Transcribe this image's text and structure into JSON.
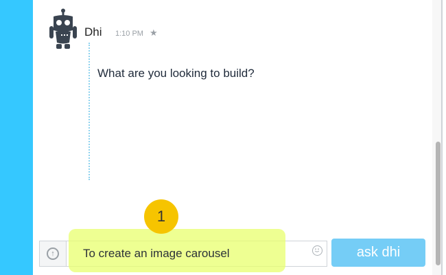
{
  "message": {
    "author": "Dhi",
    "time": "1:10 PM",
    "text": "What are you looking to build?"
  },
  "composer": {
    "input_value": "To create an image carousel",
    "send_label": "ask dhi"
  },
  "annotation": {
    "step_number": "1",
    "highlight_color": "#e8ff6e",
    "badge_color": "#f6c400"
  },
  "colors": {
    "sidebar": "#35c8ff",
    "button": "#75cdf6"
  },
  "icons": {
    "avatar": "robot-icon",
    "favorite": "star-icon",
    "upload": "upload-icon",
    "emoji": "emoji-icon"
  }
}
